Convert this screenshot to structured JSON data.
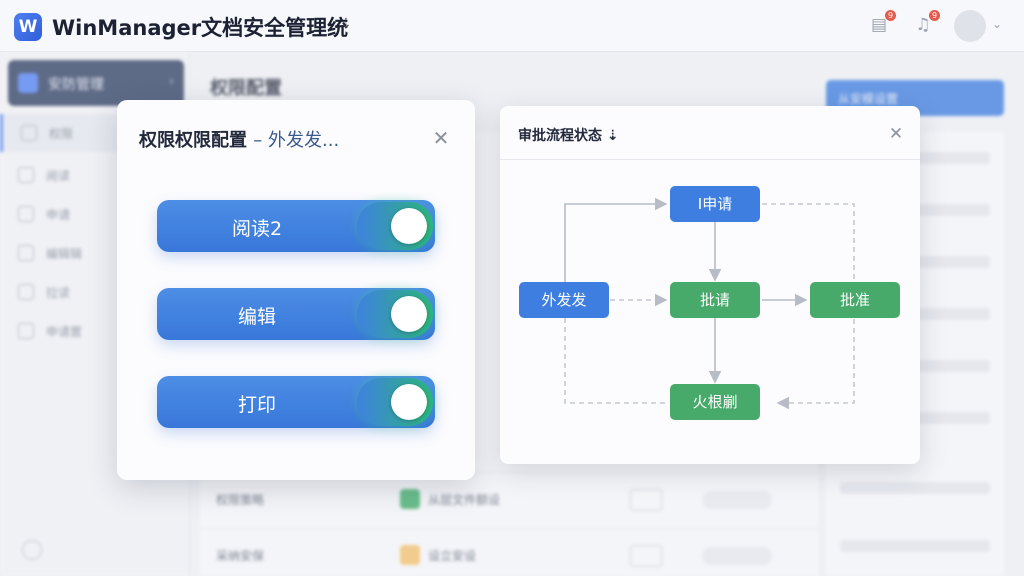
{
  "app": {
    "logo_letter": "W",
    "title": "WinManager文档安全管理统",
    "title_caret": "⇣",
    "notification_badge_1": "9",
    "notification_badge_2": "9",
    "avatar_caret": "⌄"
  },
  "sidebar": {
    "header": "安防管理",
    "items": [
      {
        "label": "权限"
      },
      {
        "label": "阅读"
      },
      {
        "label": "申请"
      },
      {
        "label": "编辑辑"
      },
      {
        "label": "拉读"
      },
      {
        "label": "申请置"
      }
    ]
  },
  "main": {
    "title": "权限配置",
    "primary_button": "从安模设置"
  },
  "background_rows": [
    {
      "label": "权限策略",
      "text": "从层文件额设"
    },
    {
      "label": "采纳安保",
      "text": "设立安设"
    }
  ],
  "permission_modal": {
    "title": "权限权限配置",
    "subtitle": "– 外发发...",
    "toggles": [
      {
        "label": "阅读2",
        "on": true
      },
      {
        "label": "编辑",
        "on": true
      },
      {
        "label": "打印",
        "on": true
      }
    ]
  },
  "approval_modal": {
    "title": "审批流程状态",
    "title_caret": "⇣",
    "nodes": {
      "apply": "I申请",
      "outgoing": "外发发",
      "review": "批请",
      "approve": "批准",
      "fire_control": "火根剻"
    }
  },
  "colors": {
    "primary": "#3d7ee0",
    "success": "#47a96a",
    "accent_switch_glow": "#2bb67a",
    "badge": "#e45b4d"
  }
}
